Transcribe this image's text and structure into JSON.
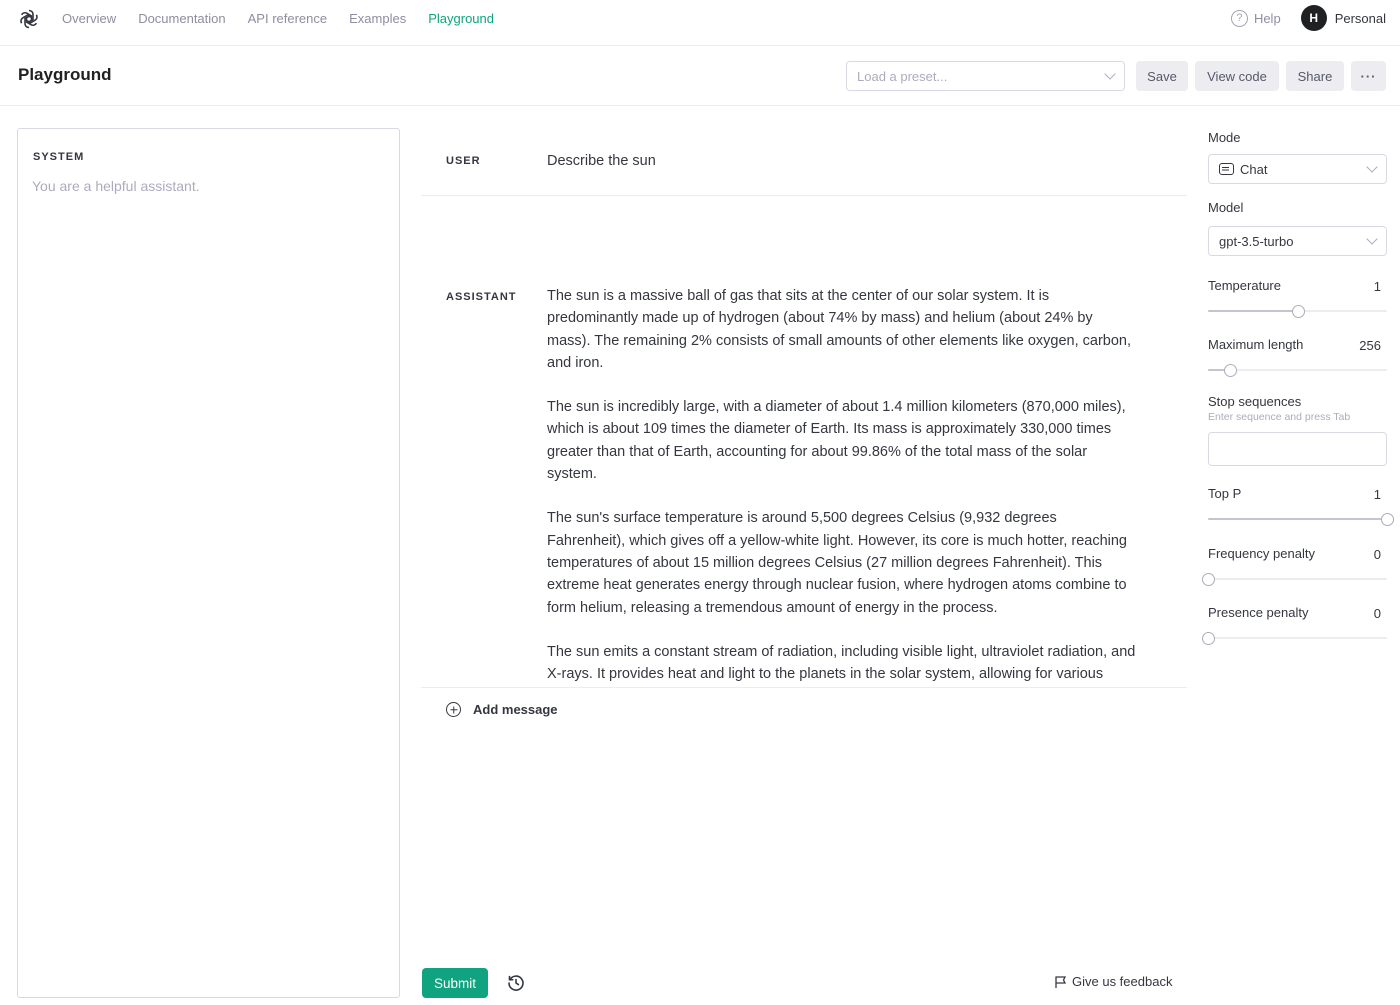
{
  "nav": {
    "links": [
      {
        "label": "Overview"
      },
      {
        "label": "Documentation"
      },
      {
        "label": "API reference"
      },
      {
        "label": "Examples"
      },
      {
        "label": "Playground",
        "active": true
      }
    ],
    "help_label": "Help",
    "avatar_initial": "H",
    "account_label": "Personal"
  },
  "header": {
    "title": "Playground",
    "preset_placeholder": "Load a preset...",
    "save_label": "Save",
    "view_code_label": "View code",
    "share_label": "Share",
    "more_label": "···"
  },
  "system": {
    "label": "SYSTEM",
    "text": "You are a helpful assistant."
  },
  "messages": [
    {
      "role": "USER",
      "text": "Describe the sun"
    },
    {
      "role": "ASSISTANT",
      "paragraphs": [
        "The sun is a massive ball of gas that sits at the center of our solar system. It is predominantly made up of hydrogen (about 74% by mass) and helium (about 24% by mass). The remaining 2% consists of small amounts of other elements like oxygen, carbon, and iron.",
        "The sun is incredibly large, with a diameter of about 1.4 million kilometers (870,000 miles), which is about 109 times the diameter of Earth. Its mass is approximately 330,000 times greater than that of Earth, accounting for about 99.86% of the total mass of the solar system.",
        "The sun's surface temperature is around 5,500 degrees Celsius (9,932 degrees Fahrenheit), which gives off a yellow-white light. However, its core is much hotter, reaching temperatures of about 15 million degrees Celsius (27 million degrees Fahrenheit). This extreme heat generates energy through nuclear fusion, where hydrogen atoms combine to form helium, releasing a tremendous amount of energy in the process.",
        "The sun emits a constant stream of radiation, including visible light, ultraviolet radiation, and X-rays. It provides heat and light to the planets in the solar system, allowing for various biological processes to occur on Earth. The energy from the sun"
      ]
    }
  ],
  "add_message_label": "Add message",
  "footer": {
    "submit_label": "Submit",
    "feedback_label": "Give us feedback"
  },
  "settings": {
    "mode": {
      "label": "Mode",
      "value": "Chat"
    },
    "model": {
      "label": "Model",
      "value": "gpt-3.5-turbo"
    },
    "temperature": {
      "label": "Temperature",
      "value": "1",
      "fraction": 0.5
    },
    "max_length": {
      "label": "Maximum length",
      "value": "256",
      "fraction": 0.125
    },
    "stop_sequences": {
      "label": "Stop sequences",
      "hint": "Enter sequence and press Tab",
      "value": ""
    },
    "top_p": {
      "label": "Top P",
      "value": "1",
      "fraction": 1.0
    },
    "frequency_penalty": {
      "label": "Frequency penalty",
      "value": "0",
      "fraction": 0.0
    },
    "presence_penalty": {
      "label": "Presence penalty",
      "value": "0",
      "fraction": 0.0
    }
  },
  "colors": {
    "accent": "#10a37f",
    "text": "#353740",
    "muted": "#8e8ea0",
    "border": "#d9d9e3"
  }
}
